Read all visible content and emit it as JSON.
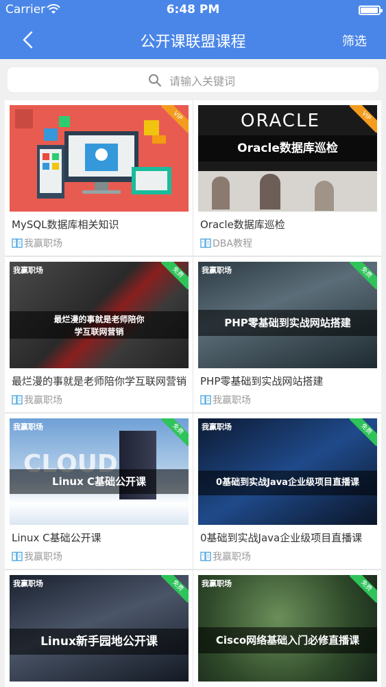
{
  "status": {
    "carrier": "Carrier",
    "time": "6:48 PM"
  },
  "nav": {
    "title": "公开课联盟课程",
    "filter": "筛选"
  },
  "search": {
    "placeholder": "请输入关键词"
  },
  "courses": [
    {
      "title": "MySQL数据库相关知识",
      "source": "我赢职场",
      "badge": "VIP"
    },
    {
      "title": "Oracle数据库巡检",
      "source": "DBA教程",
      "badge": "VIP",
      "thumb_banner": "Oracle数据库巡检",
      "thumb_logo": "ORACLE"
    },
    {
      "title": "最烂漫的事就是老师陪你学互联网营销",
      "source": "我赢职场",
      "badge": "免费",
      "thumb_line1": "最烂漫的事就是老师陪你",
      "thumb_line2": "学互联网营销",
      "brand": "我赢职场"
    },
    {
      "title": "PHP零基础到实战网站搭建",
      "source": "我赢职场",
      "badge": "免费",
      "thumb_banner": "PHP零基础到实战网站搭建",
      "brand": "我赢职场"
    },
    {
      "title": "Linux C基础公开课",
      "source": "我赢职场",
      "badge": "免费",
      "thumb_banner": "Linux C基础公开课",
      "brand": "我赢职场",
      "thumb_word": "CLOUD"
    },
    {
      "title": "0基础到实战Java企业级项目直播课",
      "source": "我赢职场",
      "badge": "免费",
      "thumb_banner": "0基础到实战Java企业级项目直播课",
      "brand": "我赢职场"
    },
    {
      "badge": "免费",
      "thumb_banner": "Linux新手园地公开课",
      "brand": "我赢职场"
    },
    {
      "badge": "免费",
      "thumb_banner": "Cisco网络基础入门必修直播课",
      "brand": "我赢职场"
    }
  ],
  "colors": {
    "primary": "#4a86e8",
    "vip": "#f39c1f",
    "free": "#2fc35a"
  }
}
